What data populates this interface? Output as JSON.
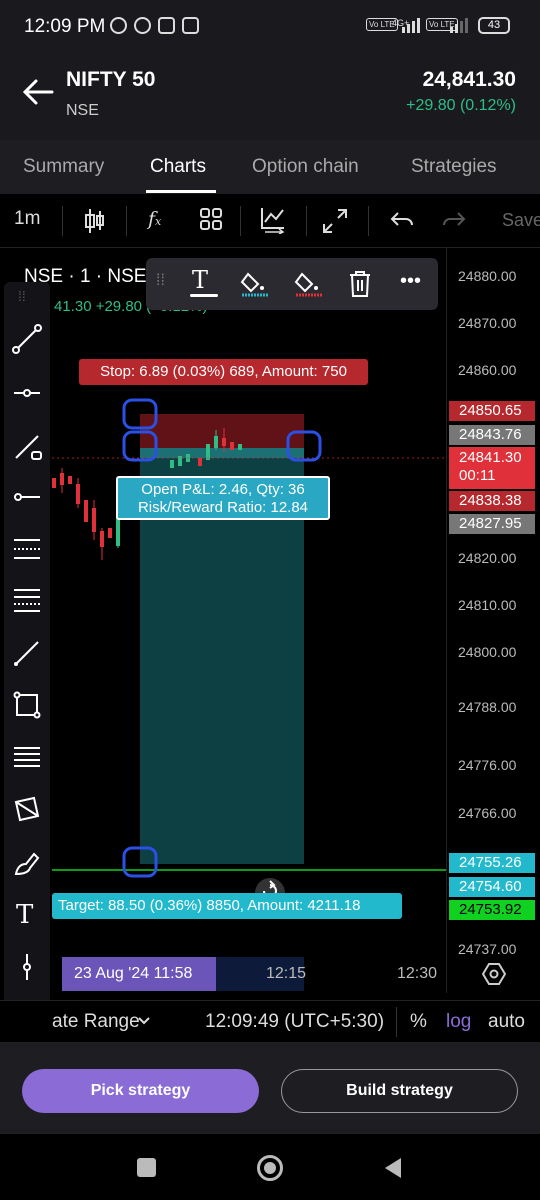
{
  "status_bar": {
    "time": "12:09 PM",
    "net1": "Vo LTE",
    "net2": "4G+",
    "net3": "Vo LTE",
    "battery": "43"
  },
  "header": {
    "title": "NIFTY 50",
    "exchange": "NSE",
    "price": "24,841.30",
    "change": "+29.80 (0.12%)"
  },
  "tabs": [
    "Summary",
    "Charts",
    "Option chain",
    "Strategies"
  ],
  "toolbar": {
    "interval": "1m",
    "save_label": "Save"
  },
  "chart": {
    "symbol_label": "NSE · 1 · NSE",
    "ohlc_partial": "41.30  +29.80  (+0.12%)",
    "stop_label": "Stop: 6.89 (0.03%) 689, Amount: 750",
    "pnl_line1": "Open P&L: 2.46, Qty: 36",
    "pnl_line2": "Risk/Reward Ratio: 12.84",
    "target_label": "Target: 88.50 (0.36%) 8850, Amount: 4211.18",
    "y_ticks": [
      "24880.00",
      "24870.00",
      "24860.00",
      "24820.00",
      "24810.00",
      "24800.00",
      "24788.00",
      "24776.00",
      "24766.00",
      "24737.00"
    ],
    "badges": [
      {
        "value": "24850.65",
        "color": "#b5282d"
      },
      {
        "value": "24843.76",
        "color": "#777777"
      },
      {
        "value": "24841.30",
        "sub": "00:11",
        "color": "#e0303a"
      },
      {
        "value": "24838.38",
        "color": "#b5282d"
      },
      {
        "value": "24827.95",
        "color": "#777777"
      },
      {
        "value": "24755.26",
        "color": "#22b9cc"
      },
      {
        "value": "24754.60",
        "color": "#22b9cc"
      },
      {
        "value": "24753.92",
        "color": "#10d020"
      }
    ],
    "time_axis": {
      "selected": "23 Aug '24   11:58",
      "t1": "12:15",
      "t2": "12:30"
    }
  },
  "range_bar": {
    "date_range": "ate Range",
    "clock": "12:09:49 (UTC+5:30)",
    "percent": "%",
    "log": "log",
    "auto": "auto"
  },
  "actions": {
    "pick": "Pick strategy",
    "build": "Build strategy"
  },
  "colors": {
    "accent": "#8b6cd6",
    "up": "#2ebd85",
    "down": "#e0303a",
    "cyan": "#22b9cc"
  }
}
